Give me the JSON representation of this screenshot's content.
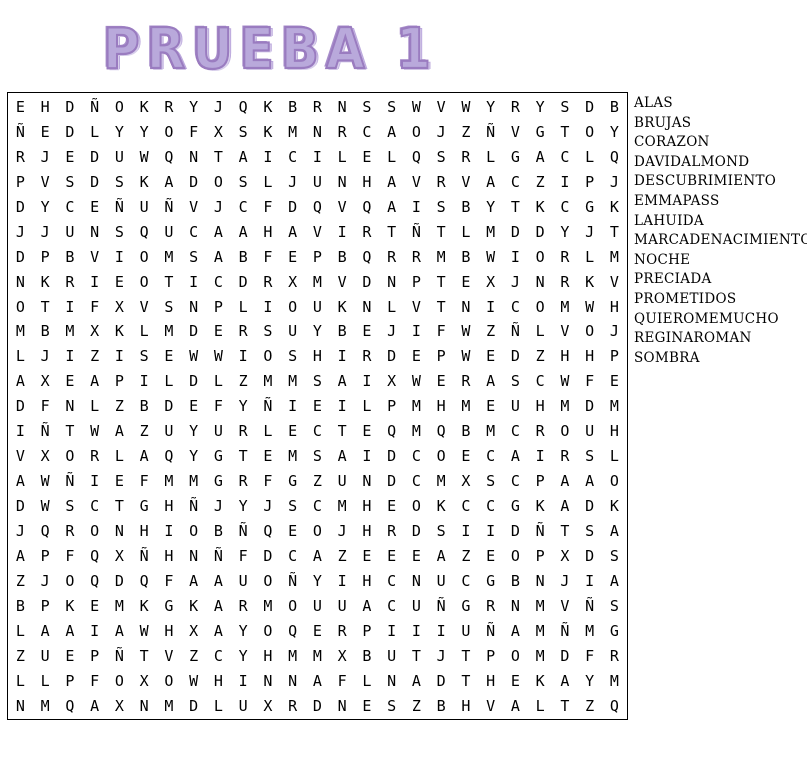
{
  "title": {
    "text": "PRUEBA 1",
    "color": "#b9a9db",
    "outline_color": "#9a7cc0"
  },
  "puzzle": {
    "rows": 25,
    "columns": 25,
    "border_color": "#000000",
    "letter_color": "#000000",
    "grid": [
      "EHDÑOKRYJQKBRNSSWVWYRYSDB",
      "ÑEDLYYOFXSKMNRCAOJZÑVGTOY",
      "RJEDUWQNTAICILELQSRLGACLQ",
      "PVSDSKADOSLJUNHAVRVACZIPJ",
      "DYCEÑUÑVJCFDQVQAISBYTKCGK",
      "JJUNSQUCAAHAVIRTÑTLMDDYJT",
      "DPBVIOMSABFEPBQRRMBWIORLM",
      "NKRIEOTICDRXMVDNPTEXJNRKV",
      "OTIFXVSNPLIOUKNLVTNICOMWH",
      "MBMXKLMDERSUYBEJIFWZÑLVOJ",
      "LJIZISEWWIOSHIRDEPWEDZHHP",
      "AXEAPILDLZMMSAIXWERASCWFE",
      "DFNLZBDEFYÑIEILPMHMEUHMDM",
      "IÑTWAZUYURLECTEQMQBMCROUH",
      "VXORLAQYGTEMSAIDCOECAIRSL",
      "AWÑIEFMMGRFGZUNDCMXSCPAAO",
      "DWSCTGHÑJYJSCMHEOKCCGKADK",
      "JQRONHIOBÑQEOJHRDSIIDÑTSA",
      "APFQXÑHNÑFDCAZEEEAZEOPXDS",
      "ZJOQDQFAAUOÑYIHCNUCGBNJIA",
      "BPKEMKGKARMOUUACUÑGRNMVÑS",
      "LAAIAWHXAYOQERPIIIUÑAMÑMG",
      "ZUEPÑTVZCYHMMXBUTJTPOMDFR",
      "LLPFOXOWHINNAFLNADTHEKAYM",
      "NMQAXNMDLUXRDNESZBHVALTZQ"
    ]
  },
  "word_list": [
    "ALAS",
    "BRUJAS",
    "CORAZON",
    "DAVIDALMOND",
    "DESCUBRIMIENTO",
    "EMMAPASS",
    "LAHUIDA",
    "MARCADENACIMIENTO",
    "NOCHE",
    "PRECIADA",
    "PROMETIDOS",
    "QUIEROMEMUCHO",
    "REGINAROMAN",
    "SOMBRA"
  ]
}
